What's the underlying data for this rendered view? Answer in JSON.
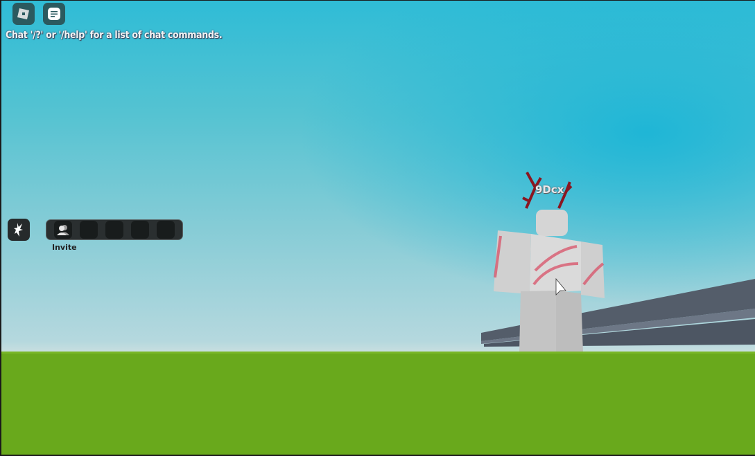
{
  "topbar": {
    "menu_icon": "roblox-logo-icon",
    "chat_icon": "chat-icon"
  },
  "chat": {
    "hint": "Chat '/?' or '/help' for a list of chat commands."
  },
  "emote": {
    "icon": "emote-icon"
  },
  "hotbar": {
    "invite_label": "Invite",
    "slots": 5
  },
  "player": {
    "name": "9Dcx"
  },
  "colors": {
    "sky_top": "#2fbcd6",
    "sky_horizon": "#cde0e0",
    "ground": "#69a91c",
    "ui_dark": "#2a2f30"
  }
}
